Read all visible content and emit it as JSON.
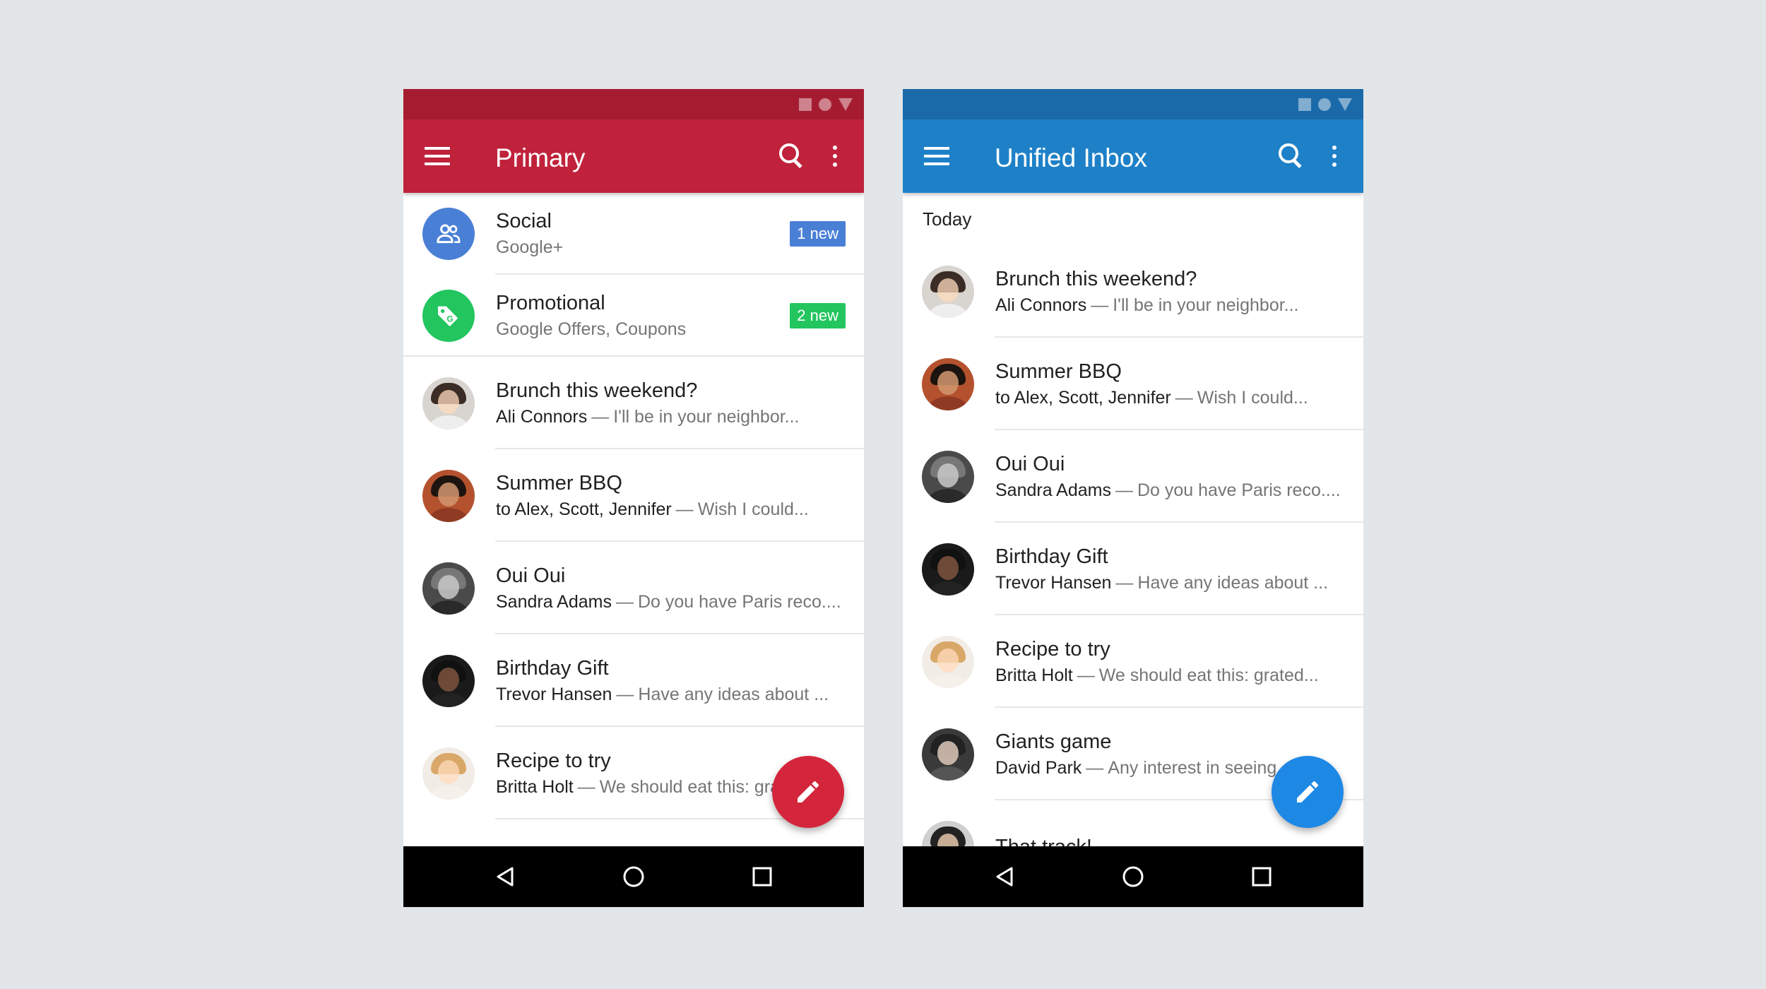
{
  "left": {
    "title": "Primary",
    "colors": {
      "statusbar": "#a51c30",
      "appbar": "#c0223b",
      "fab": "#d3263c"
    },
    "categories": [
      {
        "name": "Social",
        "source": "Google+",
        "badge": "1 new",
        "badge_color": "#4a7fd6",
        "icon_color": "#4a7fd6",
        "icon": "people-icon"
      },
      {
        "name": "Promotional",
        "source": "Google Offers, Coupons",
        "badge": "2 new",
        "badge_color": "#22c55e",
        "icon_color": "#22c55e",
        "icon": "tag-icon"
      }
    ],
    "emails": [
      {
        "subject": "Brunch this weekend?",
        "sender": "Ali Connors",
        "snippet": "I'll be in your neighbor..."
      },
      {
        "subject": "Summer BBQ",
        "sender": "to Alex, Scott, Jennifer",
        "snippet": "Wish I could..."
      },
      {
        "subject": "Oui Oui",
        "sender": "Sandra Adams",
        "snippet": "Do you have Paris reco...."
      },
      {
        "subject": "Birthday Gift",
        "sender": "Trevor Hansen",
        "snippet": "Have any ideas about ..."
      },
      {
        "subject": "Recipe to try",
        "sender": "Britta Holt",
        "snippet": "We should eat this: grated..."
      }
    ]
  },
  "right": {
    "title": "Unified Inbox",
    "colors": {
      "statusbar": "#1a6aaa",
      "appbar": "#1e81c8",
      "fab": "#1e88e5"
    },
    "section": "Today",
    "emails": [
      {
        "subject": "Brunch this weekend?",
        "sender": "Ali Connors",
        "snippet": "I'll be in your neighbor..."
      },
      {
        "subject": "Summer BBQ",
        "sender": "to Alex, Scott, Jennifer",
        "snippet": "Wish I could..."
      },
      {
        "subject": "Oui Oui",
        "sender": "Sandra Adams",
        "snippet": "Do you have Paris reco...."
      },
      {
        "subject": "Birthday Gift",
        "sender": "Trevor Hansen",
        "snippet": "Have any ideas about ..."
      },
      {
        "subject": "Recipe to try",
        "sender": "Britta Holt",
        "snippet": "We should eat this: grated..."
      },
      {
        "subject": "Giants game",
        "sender": "David Park",
        "snippet": "Any interest in seeing..."
      },
      {
        "subject": "That track!",
        "sender": "",
        "snippet": ""
      }
    ]
  },
  "dash": "—",
  "icons": {
    "menu": "menu-icon",
    "search": "search-icon",
    "more": "more-vert-icon",
    "fab": "pencil-icon",
    "back": "back-icon",
    "home": "home-icon",
    "recent": "recent-apps-icon",
    "status": [
      "stop-icon",
      "circle-icon",
      "signal-icon"
    ]
  }
}
